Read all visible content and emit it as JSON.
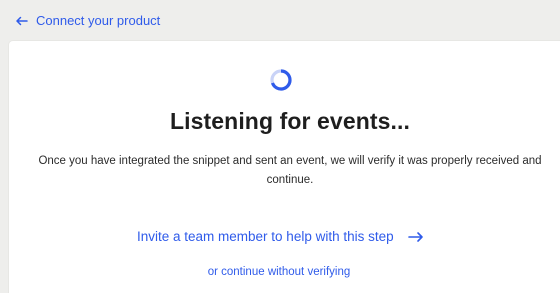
{
  "nav": {
    "back_label": "Connect your product",
    "back_icon": "arrow-left-icon"
  },
  "status": {
    "spinner_icon": "loading-spinner-icon",
    "title": "Listening for events...",
    "description": "Once you have integrated the snippet and sent an event, we will verify it was properly received and continue."
  },
  "actions": {
    "invite_label": "Invite a team member to help with this step",
    "invite_icon": "arrow-right-icon",
    "skip_label": "or continue without verifying"
  },
  "colors": {
    "accent": "#2f5bea",
    "spinner_track": "#c9d3f7",
    "background": "#eeeeec",
    "card": "#ffffff",
    "text": "#1e1e1e"
  }
}
